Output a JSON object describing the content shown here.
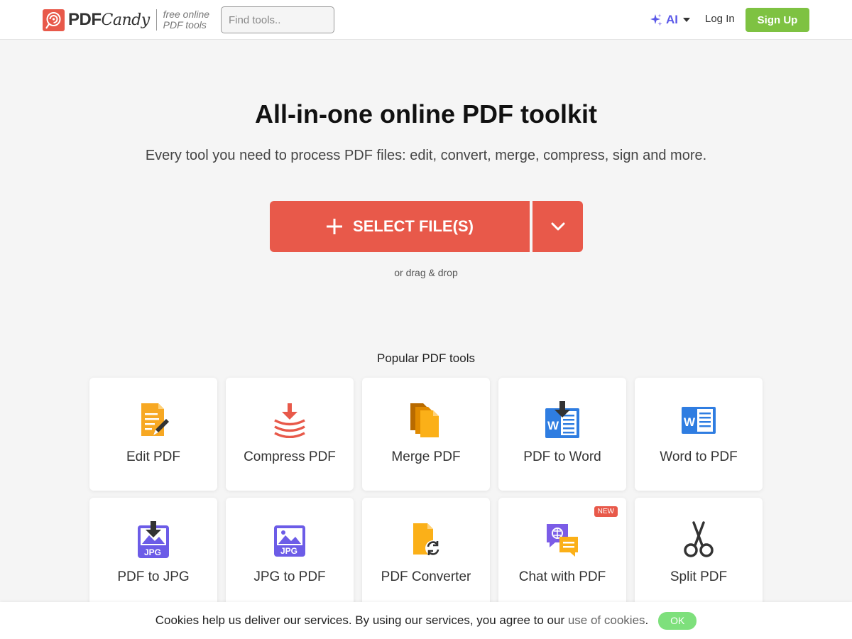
{
  "header": {
    "logo_pdf": "PDF",
    "logo_candy": "Candy",
    "tagline_line1": "free online",
    "tagline_line2": "PDF tools",
    "search_placeholder": "Find tools..",
    "ai_label": "AI",
    "login_label": "Log In",
    "signup_label": "Sign Up"
  },
  "hero": {
    "title": "All-in-one online PDF toolkit",
    "subtitle": "Every tool you need to process PDF files: edit, convert, merge, compress, sign and more.",
    "select_label": "SELECT FILE(S)",
    "drag_text": "or drag & drop"
  },
  "popular": {
    "heading": "Popular PDF tools",
    "tools": [
      {
        "label": "Edit PDF",
        "icon": "edit-pdf-icon"
      },
      {
        "label": "Compress PDF",
        "icon": "compress-pdf-icon"
      },
      {
        "label": "Merge PDF",
        "icon": "merge-pdf-icon"
      },
      {
        "label": "PDF to Word",
        "icon": "pdf-to-word-icon"
      },
      {
        "label": "Word to PDF",
        "icon": "word-to-pdf-icon"
      },
      {
        "label": "PDF to JPG",
        "icon": "pdf-to-jpg-icon"
      },
      {
        "label": "JPG to PDF",
        "icon": "jpg-to-pdf-icon"
      },
      {
        "label": "PDF Converter",
        "icon": "pdf-converter-icon"
      },
      {
        "label": "Chat with PDF",
        "icon": "chat-with-pdf-icon",
        "badge": "NEW"
      },
      {
        "label": "Split PDF",
        "icon": "scissors-icon"
      }
    ]
  },
  "cookie": {
    "text": "Cookies help us deliver our services. By using our services, you agree to our ",
    "link": "use of cookies",
    "dot": ".",
    "ok_label": "OK"
  },
  "colors": {
    "brand_red": "#e8594a",
    "signup_green": "#7ec242",
    "ai_purple": "#5a58e8",
    "ok_green": "#7ee07c"
  }
}
